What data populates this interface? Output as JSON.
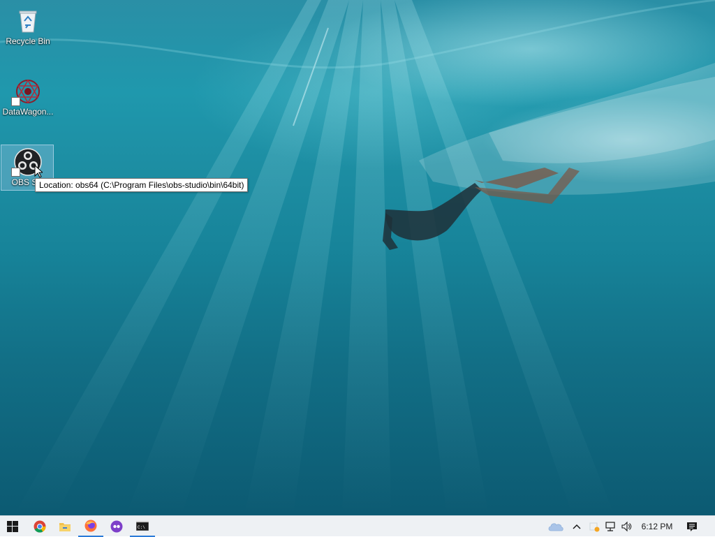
{
  "desktop": {
    "wallpaper": "underwater-freediver",
    "icons": [
      {
        "label": "Recycle Bin",
        "icon": "recycle-bin-icon"
      },
      {
        "label": "DataWagon...",
        "icon": "datawagon-icon"
      },
      {
        "label": "OBS Stu",
        "icon": "obs-studio-icon"
      }
    ],
    "tooltip": "Location: obs64 (C:\\Program Files\\obs-studio\\bin\\64bit)"
  },
  "taskbar": {
    "start": "windows-start-icon",
    "pinned": [
      {
        "name": "chrome-icon",
        "running": false
      },
      {
        "name": "file-explorer-icon",
        "running": false
      },
      {
        "name": "firefox-icon",
        "running": true
      },
      {
        "name": "tor-browser-icon",
        "running": false
      },
      {
        "name": "command-prompt-icon",
        "running": true
      }
    ],
    "cmd_glyph": "C:\\",
    "tray": [
      "onedrive-cloud-icon",
      "chevron-up-icon",
      "security-warning-icon",
      "network-icon",
      "volume-icon"
    ],
    "clock": "6:12 PM",
    "notification": "action-center-icon"
  },
  "colors": {
    "taskbar_bg": "#eef1f4",
    "running_indicator": "#2b7bd8",
    "water_top": "#2a8fa6",
    "water_bottom": "#0c5a72"
  }
}
